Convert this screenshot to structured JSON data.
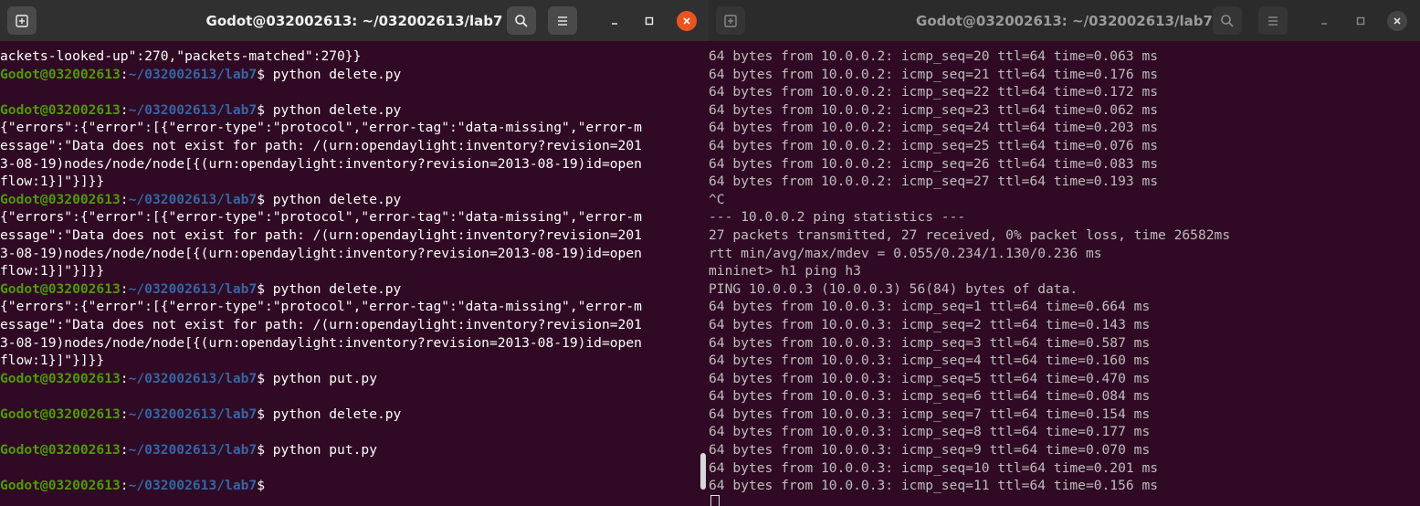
{
  "left_terminal": {
    "title": "Godot@032002613: ~/032002613/lab7",
    "colors": {
      "user": "#4e9a06",
      "path": "#3465a4",
      "close": "#e95420"
    },
    "lines": [
      {
        "type": "out",
        "text": "ackets-looked-up\":270,\"packets-matched\":270}}"
      },
      {
        "type": "prompt",
        "user": "Godot@032002613",
        "sep": ":",
        "path": "~/032002613/lab7",
        "cmd": "$ python delete.py"
      },
      {
        "type": "out",
        "text": ""
      },
      {
        "type": "prompt",
        "user": "Godot@032002613",
        "sep": ":",
        "path": "~/032002613/lab7",
        "cmd": "$ python delete.py"
      },
      {
        "type": "out",
        "text": "{\"errors\":{\"error\":[{\"error-type\":\"protocol\",\"error-tag\":\"data-missing\",\"error-m"
      },
      {
        "type": "out",
        "text": "essage\":\"Data does not exist for path: /(urn:opendaylight:inventory?revision=201"
      },
      {
        "type": "out",
        "text": "3-08-19)nodes/node/node[{(urn:opendaylight:inventory?revision=2013-08-19)id=open"
      },
      {
        "type": "out",
        "text": "flow:1}]\"}]}}"
      },
      {
        "type": "prompt",
        "user": "Godot@032002613",
        "sep": ":",
        "path": "~/032002613/lab7",
        "cmd": "$ python delete.py"
      },
      {
        "type": "out",
        "text": "{\"errors\":{\"error\":[{\"error-type\":\"protocol\",\"error-tag\":\"data-missing\",\"error-m"
      },
      {
        "type": "out",
        "text": "essage\":\"Data does not exist for path: /(urn:opendaylight:inventory?revision=201"
      },
      {
        "type": "out",
        "text": "3-08-19)nodes/node/node[{(urn:opendaylight:inventory?revision=2013-08-19)id=open"
      },
      {
        "type": "out",
        "text": "flow:1}]\"}]}}"
      },
      {
        "type": "prompt",
        "user": "Godot@032002613",
        "sep": ":",
        "path": "~/032002613/lab7",
        "cmd": "$ python delete.py"
      },
      {
        "type": "out",
        "text": "{\"errors\":{\"error\":[{\"error-type\":\"protocol\",\"error-tag\":\"data-missing\",\"error-m"
      },
      {
        "type": "out",
        "text": "essage\":\"Data does not exist for path: /(urn:opendaylight:inventory?revision=201"
      },
      {
        "type": "out",
        "text": "3-08-19)nodes/node/node[{(urn:opendaylight:inventory?revision=2013-08-19)id=open"
      },
      {
        "type": "out",
        "text": "flow:1}]\"}]}}"
      },
      {
        "type": "prompt",
        "user": "Godot@032002613",
        "sep": ":",
        "path": "~/032002613/lab7",
        "cmd": "$ python put.py"
      },
      {
        "type": "out",
        "text": ""
      },
      {
        "type": "prompt",
        "user": "Godot@032002613",
        "sep": ":",
        "path": "~/032002613/lab7",
        "cmd": "$ python delete.py"
      },
      {
        "type": "out",
        "text": ""
      },
      {
        "type": "prompt",
        "user": "Godot@032002613",
        "sep": ":",
        "path": "~/032002613/lab7",
        "cmd": "$ python put.py"
      },
      {
        "type": "out",
        "text": ""
      },
      {
        "type": "prompt",
        "user": "Godot@032002613",
        "sep": ":",
        "path": "~/032002613/lab7",
        "cmd": "$"
      }
    ]
  },
  "right_terminal": {
    "title": "Godot@032002613: ~/032002613/lab7",
    "lines": [
      "64 bytes from 10.0.0.2: icmp_seq=20 ttl=64 time=0.063 ms",
      "64 bytes from 10.0.0.2: icmp_seq=21 ttl=64 time=0.176 ms",
      "64 bytes from 10.0.0.2: icmp_seq=22 ttl=64 time=0.172 ms",
      "64 bytes from 10.0.0.2: icmp_seq=23 ttl=64 time=0.062 ms",
      "64 bytes from 10.0.0.2: icmp_seq=24 ttl=64 time=0.203 ms",
      "64 bytes from 10.0.0.2: icmp_seq=25 ttl=64 time=0.076 ms",
      "64 bytes from 10.0.0.2: icmp_seq=26 ttl=64 time=0.083 ms",
      "64 bytes from 10.0.0.2: icmp_seq=27 ttl=64 time=0.193 ms",
      "^C",
      "--- 10.0.0.2 ping statistics ---",
      "27 packets transmitted, 27 received, 0% packet loss, time 26582ms",
      "rtt min/avg/max/mdev = 0.055/0.234/1.130/0.236 ms",
      "mininet> h1 ping h3",
      "PING 10.0.0.3 (10.0.0.3) 56(84) bytes of data.",
      "64 bytes from 10.0.0.3: icmp_seq=1 ttl=64 time=0.664 ms",
      "64 bytes from 10.0.0.3: icmp_seq=2 ttl=64 time=0.143 ms",
      "64 bytes from 10.0.0.3: icmp_seq=3 ttl=64 time=0.587 ms",
      "64 bytes from 10.0.0.3: icmp_seq=4 ttl=64 time=0.160 ms",
      "64 bytes from 10.0.0.3: icmp_seq=5 ttl=64 time=0.470 ms",
      "64 bytes from 10.0.0.3: icmp_seq=6 ttl=64 time=0.084 ms",
      "64 bytes from 10.0.0.3: icmp_seq=7 ttl=64 time=0.154 ms",
      "64 bytes from 10.0.0.3: icmp_seq=8 ttl=64 time=0.177 ms",
      "64 bytes from 10.0.0.3: icmp_seq=9 ttl=64 time=0.070 ms",
      "64 bytes from 10.0.0.3: icmp_seq=10 ttl=64 time=0.201 ms",
      "64 bytes from 10.0.0.3: icmp_seq=11 ttl=64 time=0.156 ms"
    ]
  },
  "icons": {
    "new_tab": "new-tab-icon",
    "search": "search-icon",
    "menu": "hamburger-menu-icon",
    "minimize": "minimize-icon",
    "maximize": "maximize-icon",
    "close": "close-icon"
  }
}
